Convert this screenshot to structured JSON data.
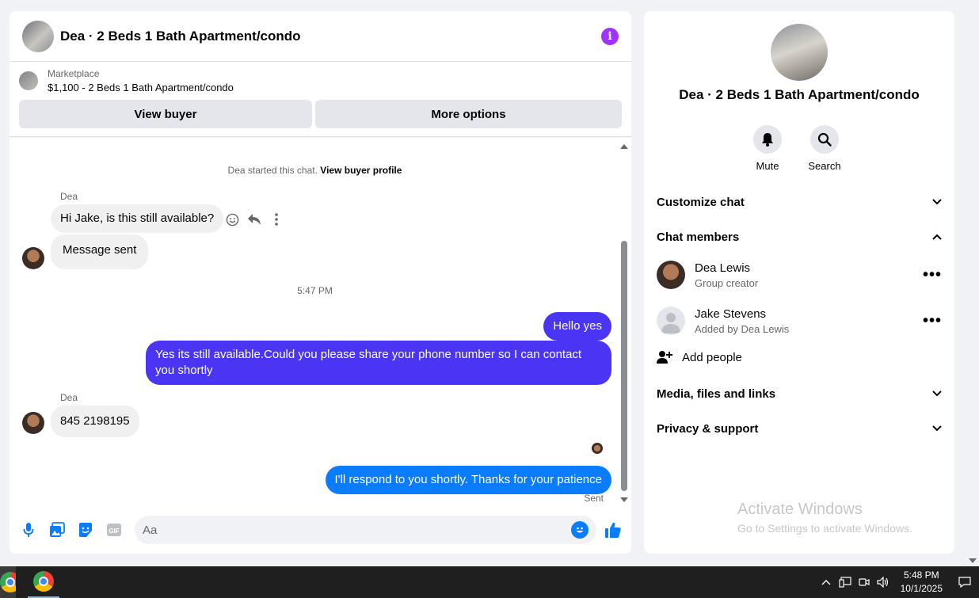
{
  "header": {
    "title": "Dea · 2 Beds 1 Bath Apartment/condo",
    "info_icon": "i"
  },
  "marketplace": {
    "label": "Marketplace",
    "listing": "$1,100 - 2 Beds 1 Bath Apartment/condo",
    "view_buyer": "View buyer",
    "more_options": "More options"
  },
  "conversation": {
    "started_text": "Dea started this chat.",
    "view_profile": "View buyer profile",
    "sender_1": "Dea",
    "msg_1": "Hi Jake, is this still available?",
    "msg_2": "Message sent",
    "timestamp": "5:47 PM",
    "msg_3": "Hello yes",
    "msg_4": "Yes its still available.Could you please share your phone number so I can contact you shortly",
    "sender_2": "Dea",
    "msg_5": "845 2198195",
    "msg_6": "I'll respond to you shortly. Thanks for your patience",
    "status": "Sent"
  },
  "composer": {
    "placeholder": "Aa",
    "gif_label": "GIF"
  },
  "side": {
    "title": "Dea · 2 Beds 1 Bath Apartment/condo",
    "mute": "Mute",
    "search": "Search",
    "customize": "Customize chat",
    "members": "Chat members",
    "member_1_name": "Dea Lewis",
    "member_1_role": "Group creator",
    "member_2_name": "Jake Stevens",
    "member_2_role": "Added by Dea Lewis",
    "add_people": "Add people",
    "media": "Media, files and links",
    "privacy": "Privacy & support",
    "more": "•••"
  },
  "watermark": {
    "line1": "Activate Windows",
    "line2": "Go to Settings to activate Windows."
  },
  "taskbar": {
    "time": "5:48 PM",
    "date": "10/1/2025"
  },
  "colors": {
    "outgoing": "#4b35f5",
    "outgoing_latest": "#0a7cff",
    "info": "#a033ff",
    "incoming": "#f0f0f0"
  }
}
